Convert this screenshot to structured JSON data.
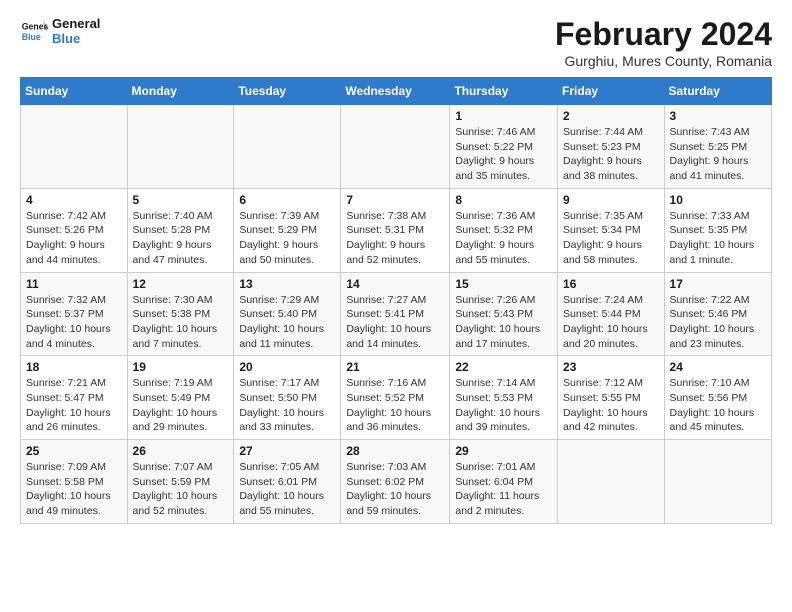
{
  "logo": {
    "line1": "General",
    "line2": "Blue"
  },
  "title": "February 2024",
  "subtitle": "Gurghiu, Mures County, Romania",
  "days_header": [
    "Sunday",
    "Monday",
    "Tuesday",
    "Wednesday",
    "Thursday",
    "Friday",
    "Saturday"
  ],
  "weeks": [
    [
      {
        "day": "",
        "info": ""
      },
      {
        "day": "",
        "info": ""
      },
      {
        "day": "",
        "info": ""
      },
      {
        "day": "",
        "info": ""
      },
      {
        "day": "1",
        "info": "Sunrise: 7:46 AM\nSunset: 5:22 PM\nDaylight: 9 hours\nand 35 minutes."
      },
      {
        "day": "2",
        "info": "Sunrise: 7:44 AM\nSunset: 5:23 PM\nDaylight: 9 hours\nand 38 minutes."
      },
      {
        "day": "3",
        "info": "Sunrise: 7:43 AM\nSunset: 5:25 PM\nDaylight: 9 hours\nand 41 minutes."
      }
    ],
    [
      {
        "day": "4",
        "info": "Sunrise: 7:42 AM\nSunset: 5:26 PM\nDaylight: 9 hours\nand 44 minutes."
      },
      {
        "day": "5",
        "info": "Sunrise: 7:40 AM\nSunset: 5:28 PM\nDaylight: 9 hours\nand 47 minutes."
      },
      {
        "day": "6",
        "info": "Sunrise: 7:39 AM\nSunset: 5:29 PM\nDaylight: 9 hours\nand 50 minutes."
      },
      {
        "day": "7",
        "info": "Sunrise: 7:38 AM\nSunset: 5:31 PM\nDaylight: 9 hours\nand 52 minutes."
      },
      {
        "day": "8",
        "info": "Sunrise: 7:36 AM\nSunset: 5:32 PM\nDaylight: 9 hours\nand 55 minutes."
      },
      {
        "day": "9",
        "info": "Sunrise: 7:35 AM\nSunset: 5:34 PM\nDaylight: 9 hours\nand 58 minutes."
      },
      {
        "day": "10",
        "info": "Sunrise: 7:33 AM\nSunset: 5:35 PM\nDaylight: 10 hours\nand 1 minute."
      }
    ],
    [
      {
        "day": "11",
        "info": "Sunrise: 7:32 AM\nSunset: 5:37 PM\nDaylight: 10 hours\nand 4 minutes."
      },
      {
        "day": "12",
        "info": "Sunrise: 7:30 AM\nSunset: 5:38 PM\nDaylight: 10 hours\nand 7 minutes."
      },
      {
        "day": "13",
        "info": "Sunrise: 7:29 AM\nSunset: 5:40 PM\nDaylight: 10 hours\nand 11 minutes."
      },
      {
        "day": "14",
        "info": "Sunrise: 7:27 AM\nSunset: 5:41 PM\nDaylight: 10 hours\nand 14 minutes."
      },
      {
        "day": "15",
        "info": "Sunrise: 7:26 AM\nSunset: 5:43 PM\nDaylight: 10 hours\nand 17 minutes."
      },
      {
        "day": "16",
        "info": "Sunrise: 7:24 AM\nSunset: 5:44 PM\nDaylight: 10 hours\nand 20 minutes."
      },
      {
        "day": "17",
        "info": "Sunrise: 7:22 AM\nSunset: 5:46 PM\nDaylight: 10 hours\nand 23 minutes."
      }
    ],
    [
      {
        "day": "18",
        "info": "Sunrise: 7:21 AM\nSunset: 5:47 PM\nDaylight: 10 hours\nand 26 minutes."
      },
      {
        "day": "19",
        "info": "Sunrise: 7:19 AM\nSunset: 5:49 PM\nDaylight: 10 hours\nand 29 minutes."
      },
      {
        "day": "20",
        "info": "Sunrise: 7:17 AM\nSunset: 5:50 PM\nDaylight: 10 hours\nand 33 minutes."
      },
      {
        "day": "21",
        "info": "Sunrise: 7:16 AM\nSunset: 5:52 PM\nDaylight: 10 hours\nand 36 minutes."
      },
      {
        "day": "22",
        "info": "Sunrise: 7:14 AM\nSunset: 5:53 PM\nDaylight: 10 hours\nand 39 minutes."
      },
      {
        "day": "23",
        "info": "Sunrise: 7:12 AM\nSunset: 5:55 PM\nDaylight: 10 hours\nand 42 minutes."
      },
      {
        "day": "24",
        "info": "Sunrise: 7:10 AM\nSunset: 5:56 PM\nDaylight: 10 hours\nand 45 minutes."
      }
    ],
    [
      {
        "day": "25",
        "info": "Sunrise: 7:09 AM\nSunset: 5:58 PM\nDaylight: 10 hours\nand 49 minutes."
      },
      {
        "day": "26",
        "info": "Sunrise: 7:07 AM\nSunset: 5:59 PM\nDaylight: 10 hours\nand 52 minutes."
      },
      {
        "day": "27",
        "info": "Sunrise: 7:05 AM\nSunset: 6:01 PM\nDaylight: 10 hours\nand 55 minutes."
      },
      {
        "day": "28",
        "info": "Sunrise: 7:03 AM\nSunset: 6:02 PM\nDaylight: 10 hours\nand 59 minutes."
      },
      {
        "day": "29",
        "info": "Sunrise: 7:01 AM\nSunset: 6:04 PM\nDaylight: 11 hours\nand 2 minutes."
      },
      {
        "day": "",
        "info": ""
      },
      {
        "day": "",
        "info": ""
      }
    ]
  ]
}
